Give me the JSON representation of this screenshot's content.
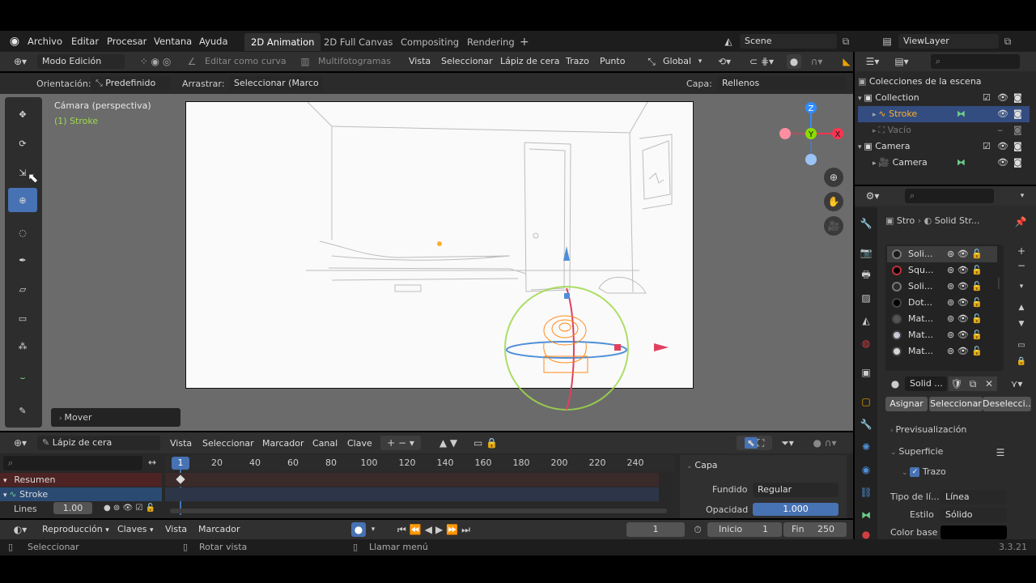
{
  "menu": {
    "items": [
      "Archivo",
      "Editar",
      "Procesar",
      "Ventana",
      "Ayuda"
    ],
    "workspaces": [
      "2D Animation",
      "2D Full Canvas",
      "Compositing",
      "Rendering"
    ],
    "add_tab_symbol": "+",
    "scene": "Scene",
    "view_layer": "ViewLayer"
  },
  "viewport_header": {
    "mode": "Modo Edición",
    "curve_edit": "Editar como curva",
    "multiframe": "Multifotogramas",
    "menus": [
      "Vista",
      "Seleccionar",
      "Lápiz de cera",
      "Trazo",
      "Punto"
    ],
    "transform_orientation": "Global"
  },
  "tool_settings": {
    "orientation_label": "Orientación:",
    "orientation_value": "Predefinido",
    "drag_label": "Arrastrar:",
    "drag_value": "Seleccionar (Marco",
    "layer_label": "Capa:",
    "layer_value": "Rellenos"
  },
  "viewport": {
    "camera_label": "Cámara (perspectiva)",
    "object_label": "(1) Stroke",
    "operator_panel": "Mover",
    "gizmo_axes": {
      "z": "Z",
      "y": "Y",
      "x": "X"
    }
  },
  "outliner": {
    "header": "Colecciones de la escena",
    "rows": [
      {
        "label": "Collection",
        "indent": 0,
        "type": "collection"
      },
      {
        "label": "Stroke",
        "indent": 1,
        "type": "gpencil",
        "selected": true
      },
      {
        "label": "Vacío",
        "indent": 1,
        "type": "empty",
        "dimmed": true
      },
      {
        "label": "Camera",
        "indent": 0,
        "type": "collection"
      },
      {
        "label": "Camera",
        "indent": 1,
        "type": "camera"
      }
    ]
  },
  "properties": {
    "breadcrumb_object": "Stro",
    "breadcrumb_material": "Solid Str...",
    "materials": [
      {
        "name": "Soli...",
        "swatch": "#1a1a1a",
        "ring": true
      },
      {
        "name": "Squ...",
        "swatch": "#000000",
        "ring_color": "#c0303a"
      },
      {
        "name": "Soli...",
        "swatch": "#2b2b2b",
        "ring": true
      },
      {
        "name": "Dot...",
        "swatch": "#000000"
      },
      {
        "name": "Mat...",
        "swatch": "#555555"
      },
      {
        "name": "Mat...",
        "swatch": "#c9c9d6"
      },
      {
        "name": "Mat...",
        "swatch": "#d6d6d6"
      }
    ],
    "active_material": "Solid ...",
    "buttons": [
      "Asignar",
      "Seleccionar",
      "Deselecci..."
    ],
    "preview_panel": "Previsualización",
    "surface_panel": "Superficie",
    "stroke_checkbox": "Trazo",
    "line_type_label": "Tipo de lí...",
    "line_type_value": "Línea",
    "style_label": "Estilo",
    "style_value": "Sólido",
    "base_color_label": "Color base",
    "base_color": "#000000"
  },
  "dopesheet": {
    "editor": "Lápiz de cera",
    "menus": [
      "Vista",
      "Seleccionar",
      "Marcador",
      "Canal",
      "Clave"
    ],
    "frame_ticks": [
      "20",
      "40",
      "60",
      "80",
      "100",
      "120",
      "140",
      "160",
      "180",
      "200",
      "220",
      "240"
    ],
    "current_frame": "1",
    "channels": [
      {
        "label": "Resumen"
      },
      {
        "label": "Stroke"
      }
    ],
    "layer_name": "Lines",
    "layer_opacity": "1.00",
    "layer_panel_title": "Capa",
    "blend_label": "Fundido",
    "blend_value": "Regular",
    "opacity_label": "Opacidad",
    "opacity_value": "1.000",
    "opacity_fraction": 1.0
  },
  "timeline": {
    "menus": [
      "Reproducción",
      "Claves",
      "Vista",
      "Marcador"
    ],
    "frame": "1",
    "start_label": "Inicio",
    "start_value": "1",
    "end_label": "Fin",
    "end_value": "250"
  },
  "statusbar": {
    "select": "Seleccionar",
    "rotate": "Rotar vista",
    "menu": "Llamar menú",
    "version": "3.3.21"
  },
  "colors": {
    "accent": "#4772b3",
    "object_active": "#ffaf29",
    "object_label": "#9dd94d",
    "x_axis": "#ff3352",
    "y_axis": "#8bdc00",
    "z_axis": "#2f8dff"
  }
}
